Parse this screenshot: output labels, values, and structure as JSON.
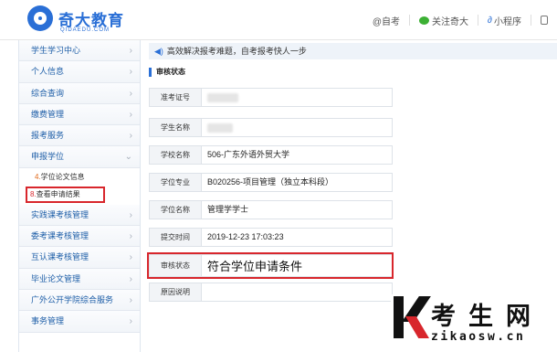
{
  "header": {
    "logo_title": "奇大教育",
    "logo_sub": "QIDAEDU.COM",
    "links": [
      "@自考",
      "关注奇大",
      "小程序"
    ]
  },
  "sidebar": {
    "items": [
      {
        "label": "学生学习中心",
        "chev": "›"
      },
      {
        "label": "个人信息",
        "chev": "›"
      },
      {
        "label": "综合查询",
        "chev": "›"
      },
      {
        "label": "缴费管理",
        "chev": "›"
      },
      {
        "label": "报考服务",
        "chev": "›"
      },
      {
        "label": "申报学位",
        "chev": "⌄"
      }
    ],
    "sub_items": [
      {
        "num": "4.",
        "label": "学位论文信息"
      },
      {
        "num": "8.",
        "label": "查看申请结果"
      }
    ],
    "items_after": [
      {
        "label": "实践课考核管理",
        "chev": "›"
      },
      {
        "label": "委考课考核管理",
        "chev": "›"
      },
      {
        "label": "互认课考核管理",
        "chev": "›"
      },
      {
        "label": "毕业论文管理",
        "chev": "›"
      },
      {
        "label": "广外公开学院综合服务",
        "chev": "›"
      },
      {
        "label": "事务管理",
        "chev": "›"
      }
    ]
  },
  "notice": "高效解决报考难题，自考报考快人一步",
  "section_title": "审核状态",
  "rows": [
    {
      "label": "准考证号",
      "value": ""
    },
    {
      "label": "学生名称",
      "value": ""
    },
    {
      "label": "学校名称",
      "value": "506-广东外语外贸大学"
    },
    {
      "label": "学位专业",
      "value": "B020256-项目管理（独立本科段）"
    },
    {
      "label": "学位名称",
      "value": "管理学学士"
    },
    {
      "label": "提交时间",
      "value": "2019-12-23 17:03:23"
    },
    {
      "label": "审核状态",
      "value": "符合学位申请条件"
    },
    {
      "label": "原因说明",
      "value": ""
    }
  ],
  "watermark": {
    "title": "考生网",
    "url": "zikaosw.cn"
  }
}
